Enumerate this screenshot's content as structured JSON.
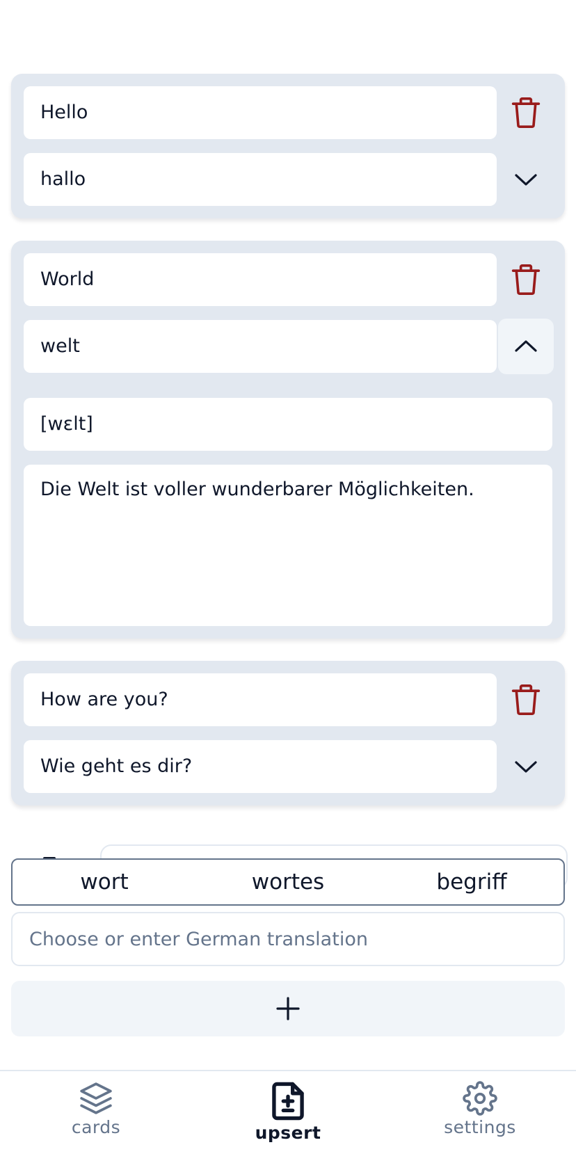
{
  "cards": [
    {
      "english": "Hello",
      "german": "hallo",
      "expanded": false
    },
    {
      "english": "World",
      "german": "welt",
      "expanded": true,
      "pronunciation": "[wɛlt]",
      "example": "Die Welt ist voller wunderbarer Möglichkeiten."
    },
    {
      "english": "How are you?",
      "german": "Wie geht es dir?",
      "expanded": false
    }
  ],
  "suggestions": [
    "wort",
    "wortes",
    "begriff"
  ],
  "new_card": {
    "german_placeholder": "Choose or enter German translation",
    "german_value": ""
  },
  "nav": {
    "cards": "cards",
    "upsert": "upsert",
    "settings": "settings",
    "active": "upsert"
  },
  "icons": {
    "delete": "trash-icon",
    "expand": "chevron-down-icon",
    "collapse": "chevron-up-icon",
    "add": "plus-icon",
    "cards": "layers-icon",
    "upsert": "file-plus-minus-icon",
    "settings": "gear-icon"
  },
  "colors": {
    "delete": "#991b1b",
    "card_bg": "#e2e8f0",
    "active_nav": "#0f172a",
    "inactive_nav": "#64748b"
  }
}
